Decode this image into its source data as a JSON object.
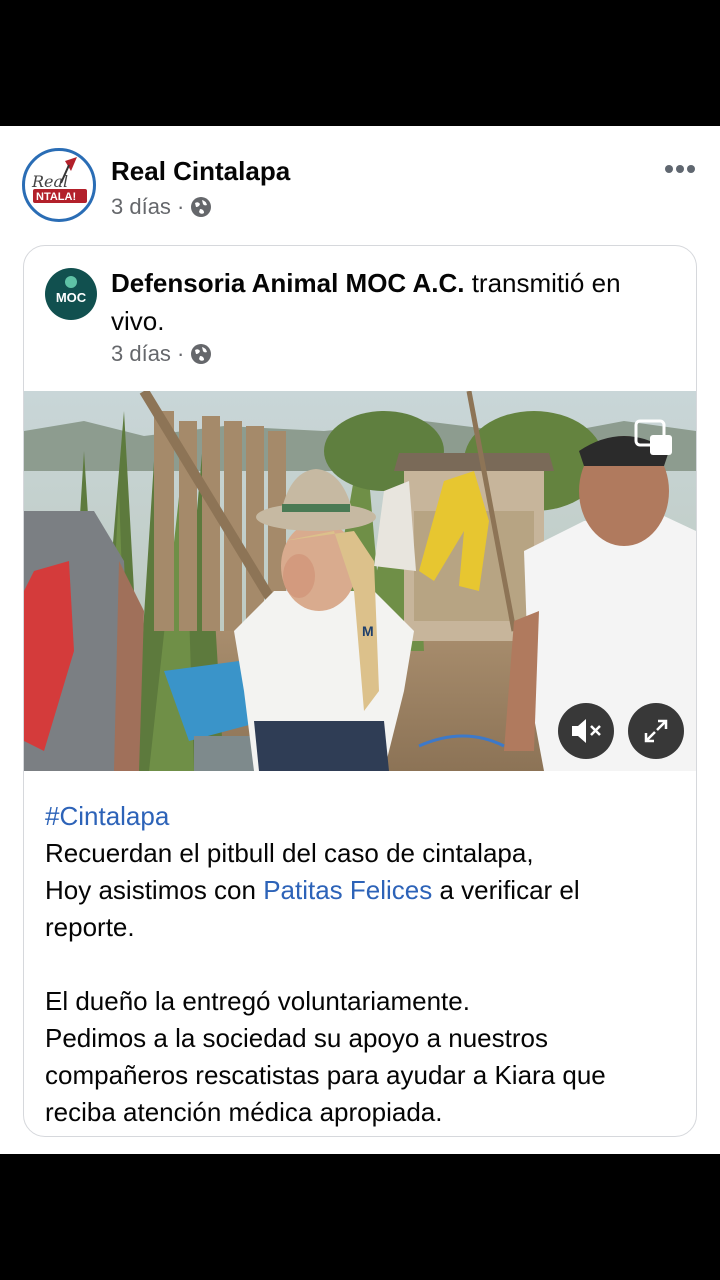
{
  "post": {
    "page_name": "Real Cintalapa",
    "time": "3 días",
    "separator": "·",
    "avatar_text_top": "Real",
    "avatar_text_bottom": "NTALA!"
  },
  "shared": {
    "page_name": "Defensoria Animal MOC A.C.",
    "action": " transmitió en vivo.",
    "time": "3 días",
    "separator": "·",
    "avatar_text": "MOC"
  },
  "video": {
    "shirt_logo": "M"
  },
  "text": {
    "hashtag": "#Cintalapa",
    "line1": "Recuerdan el pitbull del caso de cintalapa,",
    "line2_before": "Hoy asistimos con ",
    "line2_link": "Patitas Felices",
    "line2_after": " a verificar el reporte.",
    "line3": "El dueño la entregó voluntariamente.",
    "line4": "Pedimos a la sociedad su apoyo a nuestros compañeros rescatistas para ayudar a Kiara que reciba atención médica apropiada."
  },
  "colors": {
    "link": "#2d63b8",
    "meta": "#65676b",
    "moc_green": "#11504f"
  },
  "icons": [
    "globe-icon",
    "more-icon",
    "pip-icon",
    "mute-icon",
    "expand-icon"
  ]
}
